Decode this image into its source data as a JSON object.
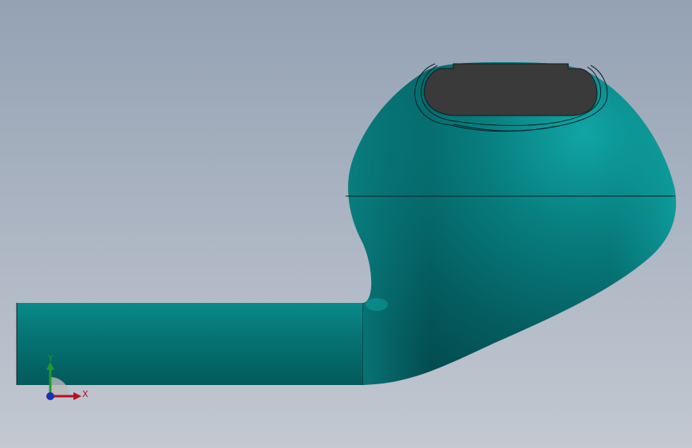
{
  "viewport": {
    "background_top_color": "#94a2b4",
    "background_bottom_color": "#c3c8d1",
    "model_color": "#067a7a",
    "model_highlight_color": "#0fa3a3",
    "model_shadow_color": "#034f52",
    "edge_color": "#0b1f22",
    "opening_color": "#3a3a3a"
  },
  "triad": {
    "x_label": "X",
    "y_label": "Y",
    "x_color": "#b3121e",
    "y_color": "#1f9a2e",
    "z_color": "#1830b8"
  }
}
